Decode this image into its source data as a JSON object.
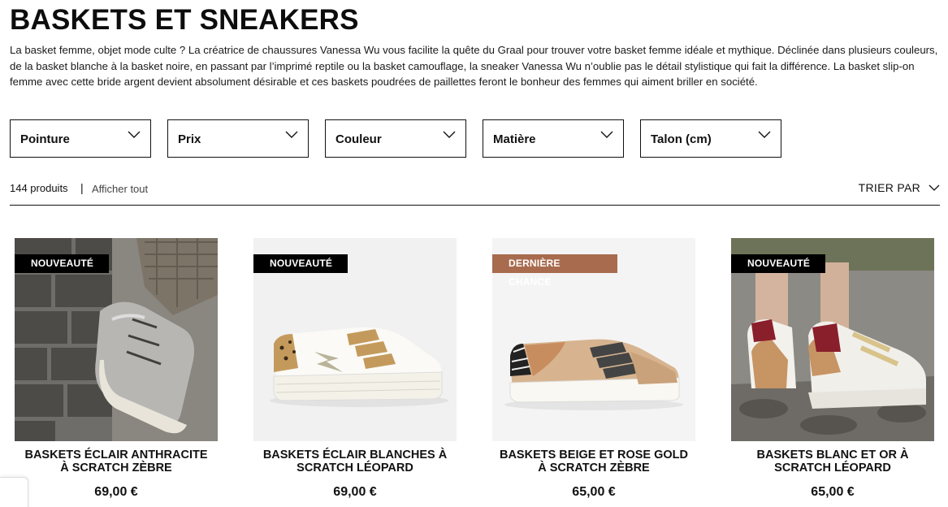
{
  "page": {
    "title": "BASKETS ET SNEAKERS",
    "intro": "La basket femme, objet mode culte ? La créatrice de chaussures Vanessa Wu vous facilite la quête du Graal pour trouver votre basket femme idéale et mythique. Déclinée dans plusieurs couleurs, de la basket blanche à la basket noire, en passant par l’imprimé reptile ou la basket camouflage, la sneaker Vanessa Wu n’oublie pas le détail stylistique qui fait la différence. La basket slip-on femme avec cette bride argent devient absolument désirable et ces baskets poudrées de paillettes feront le bonheur des femmes qui aiment briller en société."
  },
  "filters": [
    {
      "label": "Pointure"
    },
    {
      "label": "Prix"
    },
    {
      "label": "Couleur"
    },
    {
      "label": "Matière"
    },
    {
      "label": "Talon (cm)"
    }
  ],
  "toolbar": {
    "count": "144 produits",
    "separator": "|",
    "show_all": "Afficher tout",
    "sort_label": "TRIER PAR"
  },
  "products": [
    {
      "badge": "NOUVEAUTÉ",
      "name": "BASKETS ÉCLAIR ANTHRACITE À SCRATCH ZÈBRE",
      "price": "69,00 €"
    },
    {
      "badge": "NOUVEAUTÉ",
      "name": "BASKETS ÉCLAIR BLANCHES À SCRATCH LÉOPARD",
      "price": "69,00 €"
    },
    {
      "badge": "DERNIÈRE CHANCE",
      "name": "BASKETS BEIGE ET ROSE GOLD À SCRATCH ZÈBRE",
      "price": "65,00 €"
    },
    {
      "badge": "NOUVEAUTÉ",
      "name": "BASKETS BLANC ET OR À SCRATCH LÉOPARD",
      "price": "65,00 €"
    }
  ],
  "colors": {
    "badge_new": "#000000",
    "badge_last_chance": "#a86b4e",
    "text": "#111111"
  }
}
